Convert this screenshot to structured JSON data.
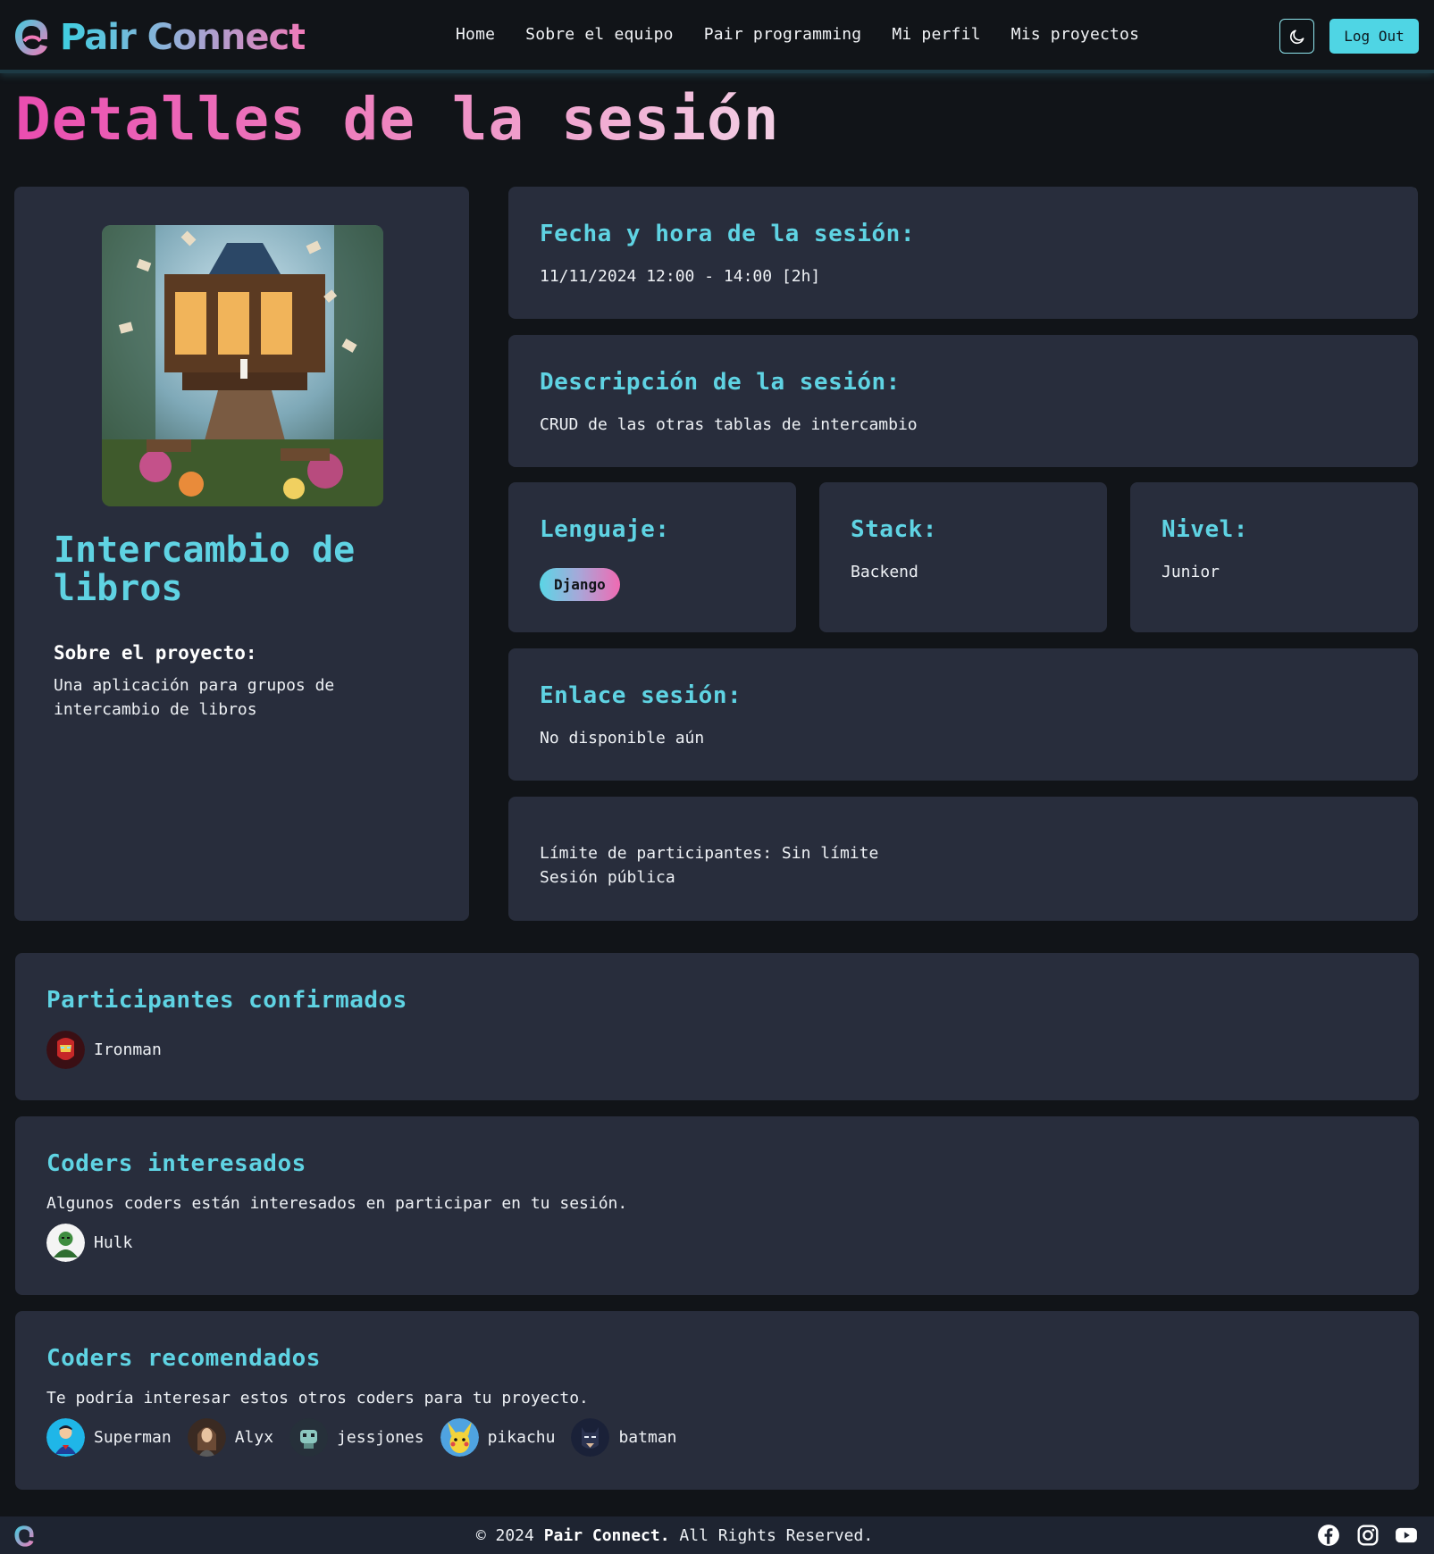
{
  "brand": {
    "name": "Pair Connect"
  },
  "nav": {
    "links": [
      "Home",
      "Sobre el equipo",
      "Pair programming",
      "Mi perfil",
      "Mis proyectos"
    ],
    "logout_label": "Log Out",
    "theme_icon": "moon-icon"
  },
  "page": {
    "title": "Detalles de la sesión"
  },
  "project": {
    "name": "Intercambio de libros",
    "about_heading": "Sobre el proyecto:",
    "about_text": "Una aplicación para grupos de intercambio de libros"
  },
  "session": {
    "datetime_heading": "Fecha y hora de la sesión:",
    "datetime_value": "11/11/2024 12:00 - 14:00 [2h]",
    "description_heading": "Descripción de la sesión:",
    "description_value": "CRUD de las otras tablas de intercambio",
    "language_heading": "Lenguaje:",
    "language_value": "Django",
    "stack_heading": "Stack:",
    "stack_value": "Backend",
    "level_heading": "Nivel:",
    "level_value": "Junior",
    "link_heading": "Enlace sesión:",
    "link_value": "No disponible aún",
    "limit_text": "Límite de participantes: Sin límite",
    "visibility_text": "Sesión pública"
  },
  "participants": {
    "heading": "Participantes confirmados",
    "users": [
      {
        "name": "Ironman",
        "avatar": "ironman-avatar",
        "color": "#9e1b1b"
      }
    ]
  },
  "interested": {
    "heading": "Coders interesados",
    "text": "Algunos coders están interesados en participar en tu sesión.",
    "users": [
      {
        "name": "Hulk",
        "avatar": "hulk-avatar",
        "color": "#2f8a3a"
      }
    ]
  },
  "recommended": {
    "heading": "Coders recomendados",
    "text": "Te podría interesar estos otros coders para tu proyecto.",
    "users": [
      {
        "name": "Superman",
        "avatar": "superman-avatar",
        "color": "#1fb6e8"
      },
      {
        "name": "Alyx",
        "avatar": "alyx-avatar",
        "color": "#6b4a35"
      },
      {
        "name": "jessjones",
        "avatar": "jessjones-avatar",
        "color": "#26303a"
      },
      {
        "name": "pikachu",
        "avatar": "pikachu-avatar",
        "color": "#f3d33a"
      },
      {
        "name": "batman",
        "avatar": "batman-avatar",
        "color": "#1a2138"
      }
    ]
  },
  "footer": {
    "copyright_prefix": "© 2024",
    "brand": "Pair Connect.",
    "copyright_suffix": "All Rights Reserved.",
    "social": [
      "facebook-icon",
      "instagram-icon",
      "youtube-icon"
    ]
  },
  "colors": {
    "background": "#111418",
    "card": "#282d3c",
    "accent_cyan": "#5fd3e3",
    "accent_pink": "#ea4db0"
  }
}
